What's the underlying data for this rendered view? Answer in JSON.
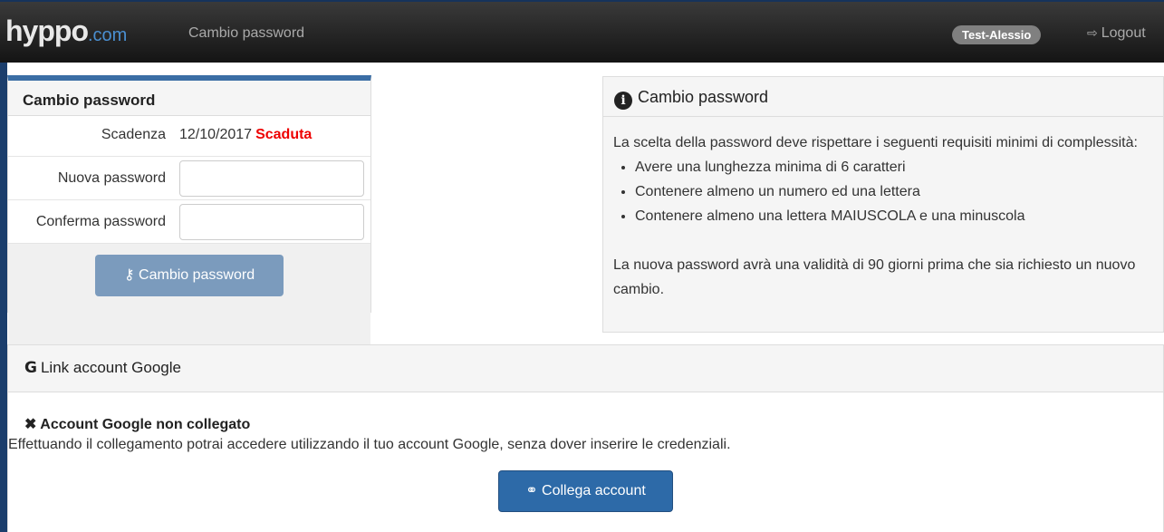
{
  "header": {
    "logo_main": "hyppo",
    "logo_suffix": ".com",
    "page_title": "Cambio password",
    "user": "Test-Alessio",
    "logout_label": "Logout"
  },
  "left_panel": {
    "title": "Cambio password",
    "expiry_label": "Scadenza",
    "expiry_date": "12/10/2017",
    "expiry_status": "Scaduta",
    "new_password_label": "Nuova password",
    "confirm_password_label": "Conferma password",
    "new_password_value": "",
    "confirm_password_value": "",
    "submit_label": "Cambio password"
  },
  "info_panel": {
    "title": "Cambio password",
    "intro": "La scelta della password deve rispettare i seguenti requisiti minimi di complessità:",
    "requirements": [
      "Avere una lunghezza minima di 6 caratteri",
      "Contenere almeno un numero ed una lettera",
      "Contenere almeno una lettera MAIUSCOLA e una minuscola"
    ],
    "validity_note": "La nuova password avrà una validità di 90 giorni prima che sia richiesto un nuovo cambio."
  },
  "google_panel": {
    "icon_letter": "G",
    "title": "Link account Google",
    "status": "Account Google non collegato",
    "description": "Effettuando il collegamento potrai accedere utilizzando il tuo account Google, senza dover inserire le credenziali.",
    "button_label": "Collega account"
  },
  "colors": {
    "navbar": "#1f1f1f",
    "primary_button": "#2d6aa8",
    "disabled_button": "#7b9bbd",
    "expired": "#e00000"
  }
}
